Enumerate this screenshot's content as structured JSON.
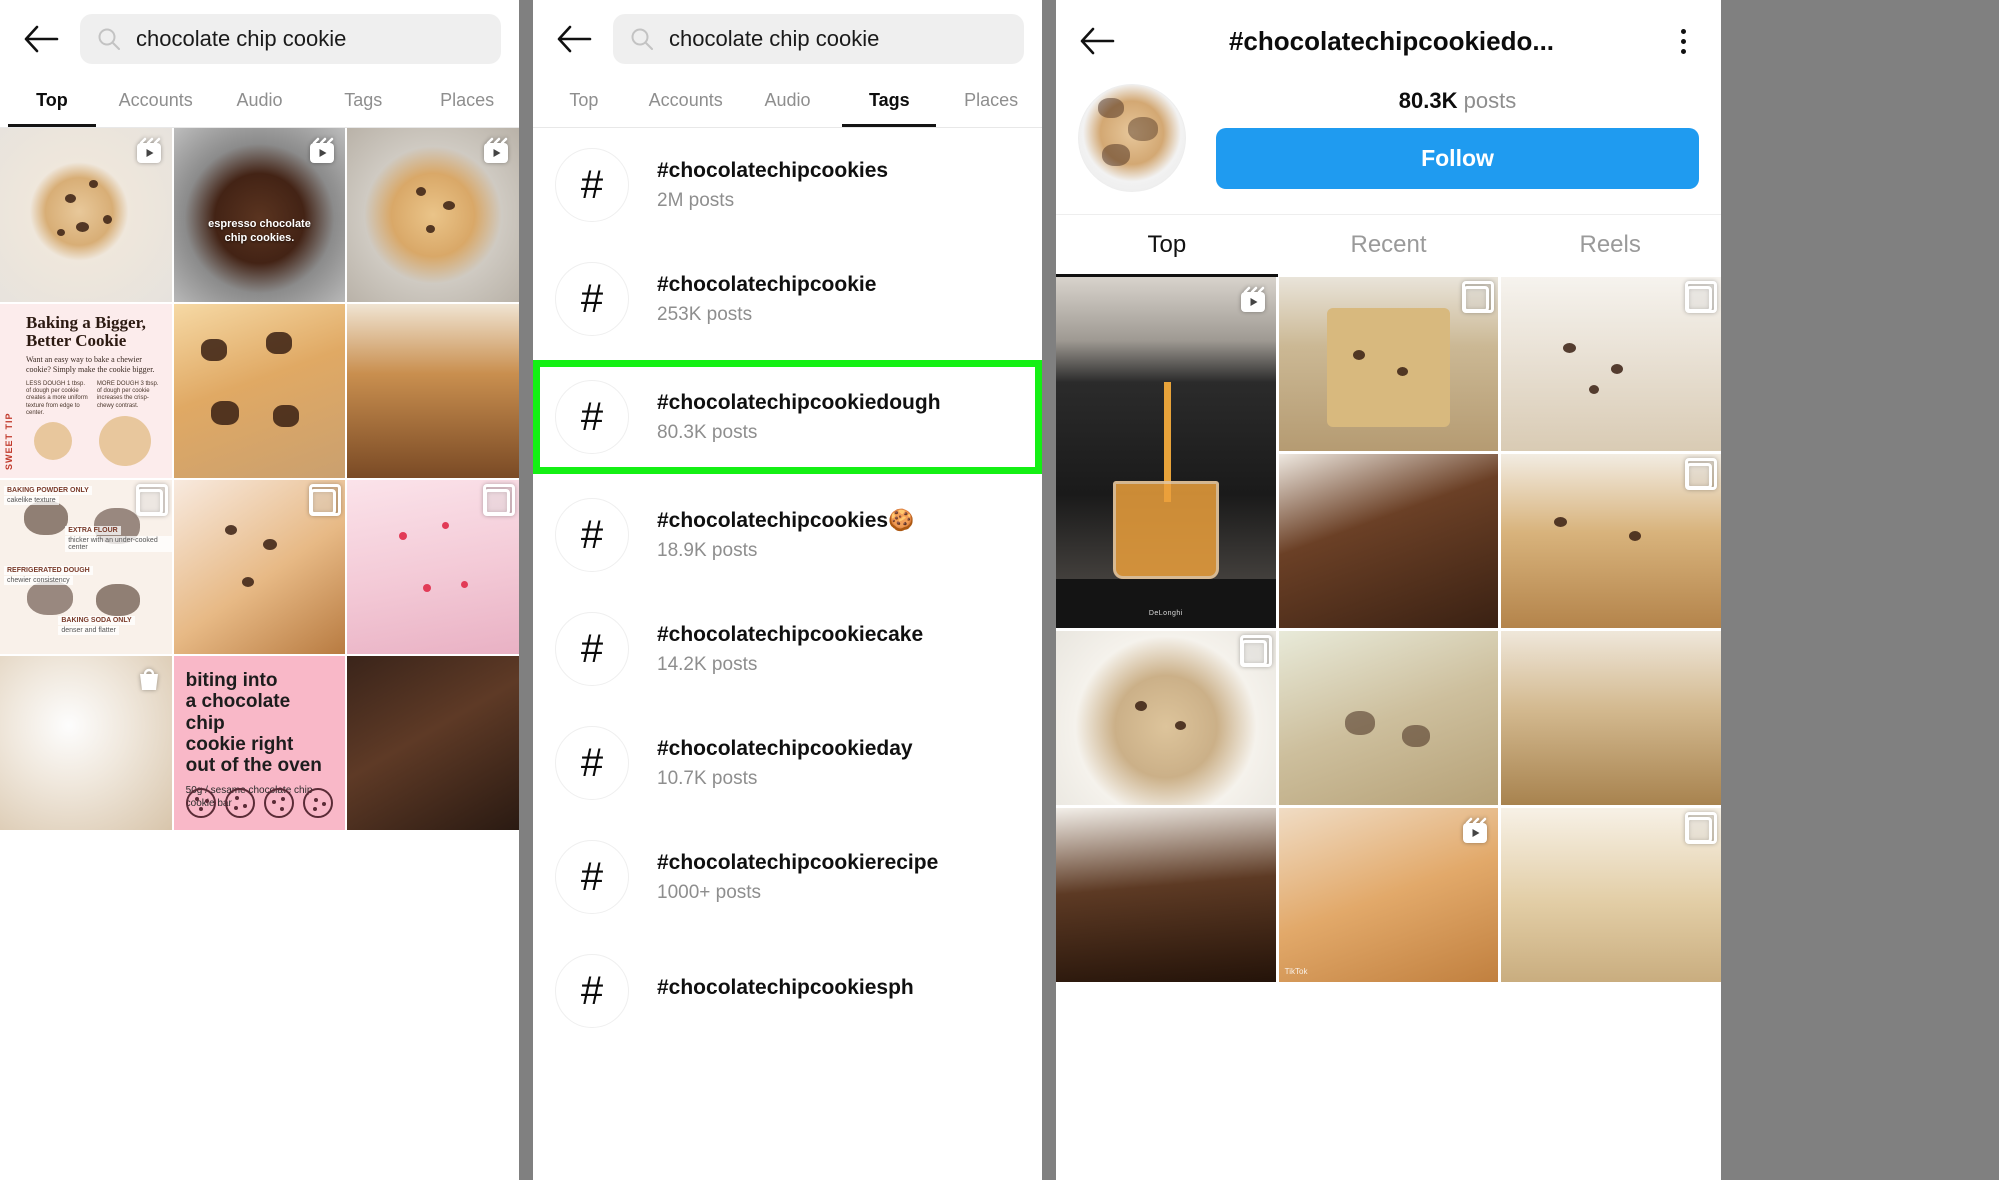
{
  "panel1": {
    "back_icon": "arrow-left-icon",
    "search": {
      "value": "chocolate chip cookie",
      "placeholder": "Search",
      "icon": "search-icon"
    },
    "tabs": [
      {
        "label": "Top",
        "active": true
      },
      {
        "label": "Accounts",
        "active": false
      },
      {
        "label": "Audio",
        "active": false
      },
      {
        "label": "Tags",
        "active": false
      },
      {
        "label": "Places",
        "active": false
      }
    ],
    "grid": [
      {
        "kind": "photo",
        "style": "cookie-bg-a",
        "badge": "reels-icon",
        "caption": ""
      },
      {
        "kind": "photo",
        "style": "cookie-bg-b",
        "badge": "reels-icon",
        "caption": "espresso chocolate\nchip cookies."
      },
      {
        "kind": "photo",
        "style": "cookie-bg-c",
        "badge": "reels-icon",
        "caption": ""
      },
      {
        "kind": "infocard",
        "style": "",
        "badge": "",
        "caption": ""
      },
      {
        "kind": "photo",
        "style": "cookie-bg-d",
        "badge": "",
        "caption": ""
      },
      {
        "kind": "photo",
        "style": "cookie-bg-e",
        "badge": "",
        "caption": ""
      },
      {
        "kind": "labelcard",
        "style": "",
        "badge": "carousel-icon",
        "caption": ""
      },
      {
        "kind": "photo",
        "style": "cookie-bg-g",
        "badge": "carousel-icon",
        "caption": ""
      },
      {
        "kind": "photo",
        "style": "cookie-bg-h",
        "badge": "carousel-icon",
        "caption": ""
      },
      {
        "kind": "photo",
        "style": "cookie-bg-f",
        "badge": "shop-icon",
        "caption": ""
      },
      {
        "kind": "pinkcard",
        "style": "",
        "badge": "",
        "caption": ""
      },
      {
        "kind": "photo",
        "style": "cookie-bg-i",
        "badge": "",
        "caption": ""
      }
    ],
    "infocard": {
      "side_tip": "SWEET TIP",
      "title": "Baking a Bigger,\nBetter Cookie",
      "body": "Want an easy way to bake a chewier cookie? Simply make the cookie bigger.",
      "col1": "LESS DOUGH\n1 tbsp. of dough per cookie creates a more uniform texture from edge to center.",
      "col2": "MORE DOUGH\n3 tbsp. of dough per cookie increases the crisp-chewy contrast."
    },
    "labelcard": {
      "l1": "BAKING POWDER ONLY",
      "l1b": "cakelike texture",
      "l2": "EXTRA FLOUR",
      "l2b": "thicker with an under-cooked center",
      "l3": "REFRIGERATED DOUGH",
      "l3b": "chewier consistency",
      "l4": "BAKING SODA ONLY",
      "l4b": "denser and flatter"
    },
    "pinkcard": {
      "title": "biting into\na chocolate chip\ncookie right\nout of the oven",
      "sub": "50g / sesame chocolate chip\ncookie bar"
    }
  },
  "panel2": {
    "back_icon": "arrow-left-icon",
    "search": {
      "value": "chocolate chip cookie",
      "placeholder": "Search",
      "icon": "search-icon"
    },
    "tabs": [
      {
        "label": "Top",
        "active": false
      },
      {
        "label": "Accounts",
        "active": false
      },
      {
        "label": "Audio",
        "active": false
      },
      {
        "label": "Tags",
        "active": true
      },
      {
        "label": "Places",
        "active": false
      }
    ],
    "hash_glyph": "#",
    "results": [
      {
        "name": "#chocolatechipcookies",
        "count": "2M posts",
        "highlighted": false
      },
      {
        "name": "#chocolatechipcookie",
        "count": "253K posts",
        "highlighted": false
      },
      {
        "name": "#chocolatechipcookiedough",
        "count": "80.3K posts",
        "highlighted": true
      },
      {
        "name": "#chocolatechipcookies🍪",
        "count": "18.9K posts",
        "highlighted": false
      },
      {
        "name": "#chocolatechipcookiecake",
        "count": "14.2K posts",
        "highlighted": false
      },
      {
        "name": "#chocolatechipcookieday",
        "count": "10.7K posts",
        "highlighted": false
      },
      {
        "name": "#chocolatechipcookierecipe",
        "count": "1000+ posts",
        "highlighted": false
      },
      {
        "name": "#chocolatechipcookiesph",
        "count": "",
        "highlighted": false
      }
    ],
    "highlight_color": "#14f014"
  },
  "panel3": {
    "back_icon": "arrow-left-icon",
    "title": "#chocolatechipcookiedo...",
    "menu_icon": "kebab-menu-icon",
    "avatar": "hashtag-avatar",
    "post_count_value": "80.3K",
    "post_count_label": " posts",
    "follow_label": "Follow",
    "follow_color": "#1f9bf0",
    "tabs": [
      {
        "label": "Top",
        "active": true
      },
      {
        "label": "Recent",
        "active": false
      },
      {
        "label": "Reels",
        "active": false
      }
    ],
    "grid": [
      {
        "style": "coffee",
        "badge": "reels-icon"
      },
      {
        "style": "jar",
        "badge": "carousel-icon"
      },
      {
        "style": "milk",
        "badge": "carousel-icon"
      },
      {
        "style": "brownie",
        "badge": ""
      },
      {
        "style": "stack",
        "badge": "carousel-icon"
      },
      {
        "style": "plate",
        "badge": "carousel-icon"
      },
      {
        "style": "greens",
        "badge": ""
      },
      {
        "style": "bars",
        "badge": ""
      },
      {
        "style": "cakeslice",
        "badge": ""
      },
      {
        "style": "hands",
        "badge": "reels-icon"
      },
      {
        "style": "shake",
        "badge": "carousel-icon"
      }
    ]
  }
}
